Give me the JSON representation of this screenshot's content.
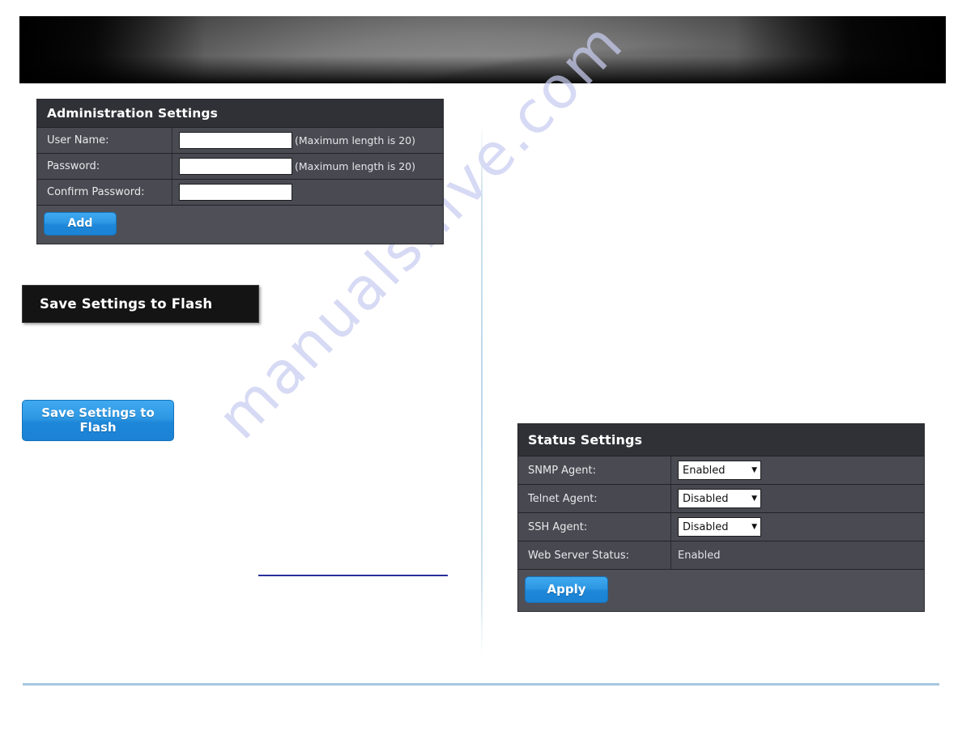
{
  "banner": {
    "name": "product-header-banner"
  },
  "watermark": {
    "text": "manualshive.com"
  },
  "admin_panel": {
    "title": "Administration Settings",
    "rows": [
      {
        "label": "User Name:",
        "value": "",
        "hint": "(Maximum length is 20)"
      },
      {
        "label": "Password:",
        "value": "",
        "hint": "(Maximum length is 20)"
      },
      {
        "label": "Confirm Password:",
        "value": "",
        "hint": ""
      }
    ],
    "add_label": "Add"
  },
  "section_bar": {
    "label": "Save Settings to Flash"
  },
  "save_button": {
    "label": "Save Settings to Flash"
  },
  "status_panel": {
    "title": "Status Settings",
    "rows": [
      {
        "label": "SNMP Agent:",
        "value": "Enabled",
        "type": "select",
        "options": [
          "Enabled",
          "Disabled"
        ]
      },
      {
        "label": "Telnet Agent:",
        "value": "Disabled",
        "type": "select",
        "options": [
          "Enabled",
          "Disabled"
        ]
      },
      {
        "label": "SSH Agent:",
        "value": "Disabled",
        "type": "select",
        "options": [
          "Enabled",
          "Disabled"
        ]
      },
      {
        "label": "Web Server Status:",
        "value": "Enabled",
        "type": "text"
      }
    ],
    "apply_label": "Apply"
  },
  "colors": {
    "panel_body": "#4b4c53",
    "panel_header": "#2f3137",
    "button_blue": "#2d97e3",
    "footer_rule": "#a7c8e0",
    "blue_rule": "#2a2f9b",
    "watermark": "#c9cdf0"
  },
  "icons": {
    "caret": "▼"
  }
}
